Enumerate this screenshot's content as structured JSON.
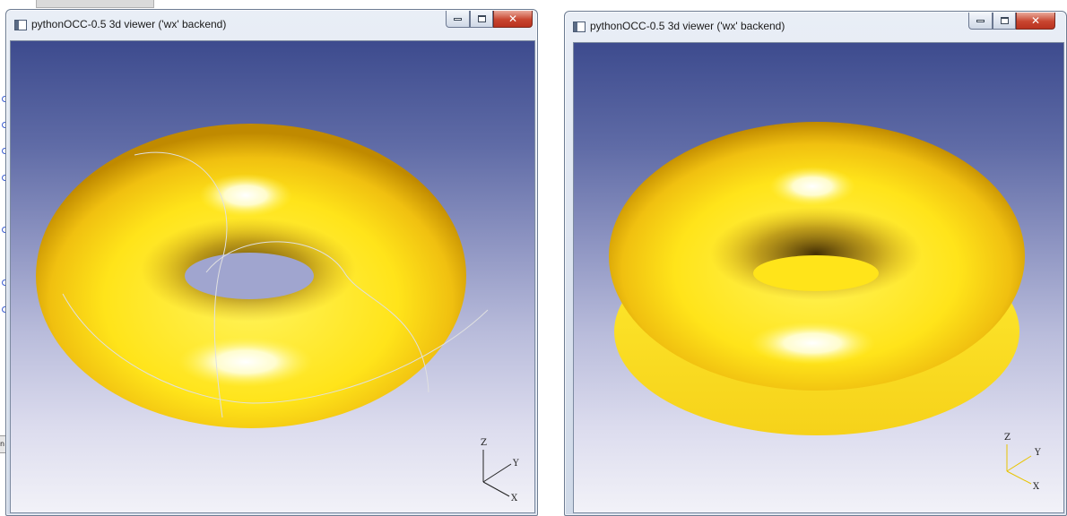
{
  "windows": [
    {
      "title": "pythonOCC-0.5 3d viewer ('wx' backend)",
      "view": "torus with seam edges",
      "triad": {
        "z": "Z",
        "y": "Y",
        "x": "X",
        "color": "#222222"
      }
    },
    {
      "title": "pythonOCC-0.5 3d viewer ('wx' backend)",
      "view": "cut torus",
      "triad": {
        "z": "Z",
        "y": "Y",
        "x": "X",
        "color": "#e8c400"
      }
    }
  ],
  "background_partial": {
    "tab_text": "n: z"
  },
  "colors": {
    "viewport_top": "#3d4b8e",
    "viewport_bottom": "#f2f2f8",
    "torus_yellow": "#ffe620",
    "torus_highlight": "#ffffff",
    "torus_shadow": "#5a3a00"
  },
  "icons": [
    "app-icon",
    "minimize-icon",
    "maximize-icon",
    "close-icon"
  ]
}
